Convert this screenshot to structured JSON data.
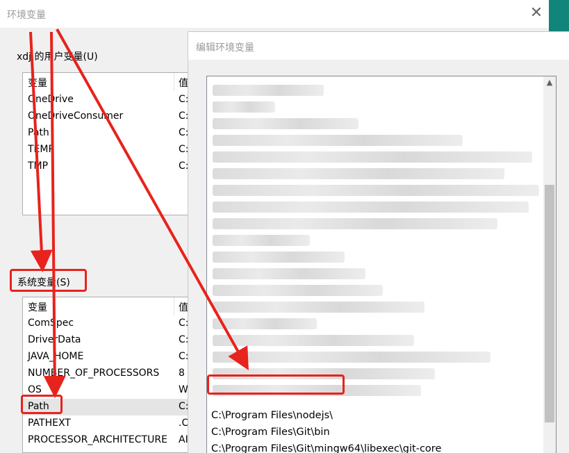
{
  "main_window": {
    "title": "环境变量",
    "close_glyph": "✕",
    "user_section_label": "xdj 的用户变量(U)",
    "system_section_label": "系统变量(S)",
    "columns": {
      "variable": "变量",
      "value": "值"
    },
    "user_vars": [
      {
        "name": "OneDrive",
        "value": "C:"
      },
      {
        "name": "OneDriveConsumer",
        "value": "C:"
      },
      {
        "name": "Path",
        "value": "C:"
      },
      {
        "name": "TEMP",
        "value": "C:"
      },
      {
        "name": "TMP",
        "value": "C:"
      }
    ],
    "system_vars": [
      {
        "name": "ComSpec",
        "value": "C:"
      },
      {
        "name": "DriverData",
        "value": "C:"
      },
      {
        "name": "JAVA_HOME",
        "value": "C:"
      },
      {
        "name": "NUMBER_OF_PROCESSORS",
        "value": "8"
      },
      {
        "name": "OS",
        "value": "W"
      },
      {
        "name": "Path",
        "value": "C:"
      },
      {
        "name": "PATHEXT",
        "value": ".C"
      },
      {
        "name": "PROCESSOR_ARCHITECTURE",
        "value": "AI"
      }
    ]
  },
  "edit_window": {
    "title": "编辑环境变量",
    "visible_paths": [
      "C:\\Program Files\\nodejs\\",
      "C:\\Program Files\\Git\\bin",
      "C:\\Program Files\\Git\\mingw64\\libexec\\git-core"
    ],
    "scroll_up_glyph": "▲",
    "scroll_down_glyph": "▼"
  },
  "annotations": {
    "color": "#e8221c"
  }
}
